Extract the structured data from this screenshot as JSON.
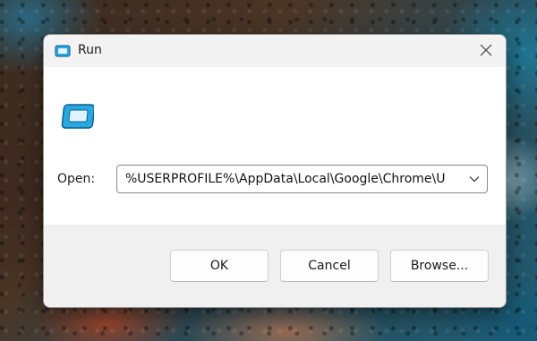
{
  "dialog": {
    "title": "Run",
    "title_icon": "run-icon",
    "close_icon": "close-icon"
  },
  "form": {
    "large_icon": "run-icon",
    "open_label": "Open:",
    "open_value": "%USERPROFILE%\\AppData\\Local\\Google\\Chrome\\U",
    "dropdown_icon": "chevron-down-icon"
  },
  "buttons": {
    "ok": "OK",
    "cancel": "Cancel",
    "browse": "Browse..."
  },
  "colors": {
    "icon_blue": "#2aa7e0",
    "icon_dark": "#0b5e8e"
  }
}
